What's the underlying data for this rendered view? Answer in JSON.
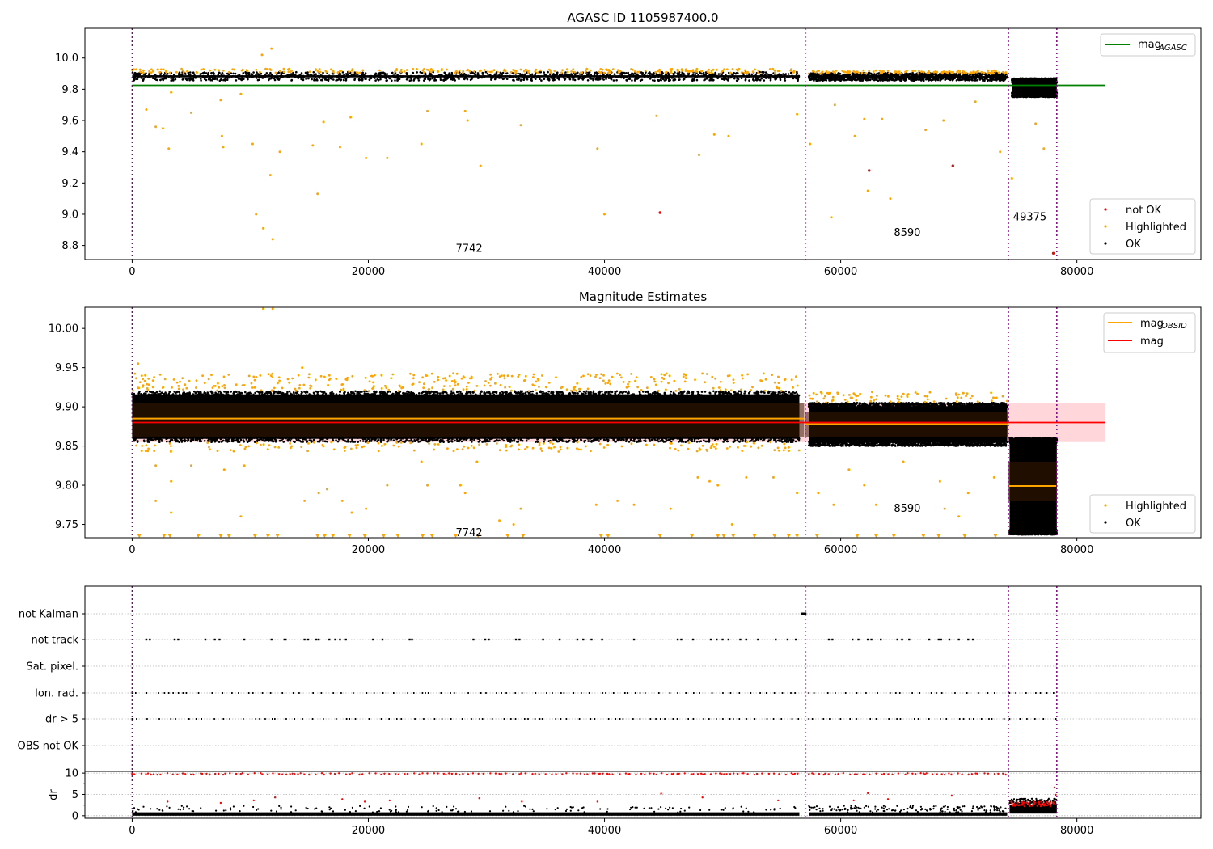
{
  "chart_data": [
    {
      "type": "scatter",
      "title": "AGASC ID 1105987400.0",
      "xlabel": "",
      "ylabel": "",
      "xlim": [
        -4000,
        90500
      ],
      "ylim": [
        8.71,
        10.19
      ],
      "x_ticks": [
        0,
        20000,
        40000,
        60000,
        80000
      ],
      "x_tick_labels": [
        "0",
        "20000",
        "40000",
        "60000",
        "80000"
      ],
      "y_ticks": [
        8.8,
        9.0,
        9.2,
        9.4,
        9.6,
        9.8,
        10.0
      ],
      "y_tick_labels": [
        "8.8",
        "9.0",
        "9.2",
        "9.4",
        "9.6",
        "9.8",
        "10.0"
      ],
      "obsid_boundaries": [
        0,
        57000,
        74200,
        78300
      ],
      "annotations": [
        {
          "text": "7742",
          "x": 27400,
          "y": 8.76
        },
        {
          "text": "8590",
          "x": 64500,
          "y": 8.86
        },
        {
          "text": "49375",
          "x": 74600,
          "y": 8.96
        }
      ],
      "lines": [
        {
          "name": "mag_AGASC",
          "value": 9.825,
          "x_range": [
            0,
            82400
          ],
          "color": "#008000"
        }
      ],
      "legend_lines": {
        "main": "mag",
        "sub": "AGASC"
      },
      "legend_points": [
        "not OK",
        "Highlighted",
        "OK"
      ],
      "series": [
        {
          "name": "OK",
          "color": "#000000",
          "bands": [
            {
              "x_range": [
                0,
                56500
              ],
              "y_range": [
                9.855,
                9.91
              ]
            },
            {
              "x_range": [
                57300,
                74100
              ],
              "y_range": [
                9.855,
                9.905
              ]
            },
            {
              "x_range": [
                74500,
                78300
              ],
              "y_range": [
                9.75,
                9.87
              ]
            }
          ]
        },
        {
          "name": "Highlighted",
          "color": "#ffa500",
          "points": [
            [
              1200,
              9.67
            ],
            [
              2000,
              9.56
            ],
            [
              2600,
              9.55
            ],
            [
              3100,
              9.42
            ],
            [
              3300,
              9.78
            ],
            [
              5000,
              9.65
            ],
            [
              7500,
              9.73
            ],
            [
              7600,
              9.5
            ],
            [
              7700,
              9.43
            ],
            [
              9200,
              9.77
            ],
            [
              10200,
              9.45
            ],
            [
              10500,
              9.0
            ],
            [
              11100,
              8.91
            ],
            [
              11000,
              10.02
            ],
            [
              11800,
              10.06
            ],
            [
              11700,
              9.25
            ],
            [
              11900,
              8.84
            ],
            [
              12500,
              9.4
            ],
            [
              15300,
              9.44
            ],
            [
              15700,
              9.13
            ],
            [
              16200,
              9.59
            ],
            [
              17600,
              9.43
            ],
            [
              18500,
              9.62
            ],
            [
              19800,
              9.36
            ],
            [
              21600,
              9.36
            ],
            [
              24500,
              9.45
            ],
            [
              25000,
              9.66
            ],
            [
              28200,
              9.66
            ],
            [
              28400,
              9.6
            ],
            [
              29500,
              9.31
            ],
            [
              32900,
              9.57
            ],
            [
              39400,
              9.42
            ],
            [
              40000,
              9.0
            ],
            [
              44400,
              9.63
            ],
            [
              48000,
              9.38
            ],
            [
              49300,
              9.51
            ],
            [
              50500,
              9.5
            ],
            [
              56300,
              9.64
            ],
            [
              57400,
              9.45
            ],
            [
              59200,
              8.98
            ],
            [
              59500,
              9.7
            ],
            [
              61200,
              9.5
            ],
            [
              62000,
              9.61
            ],
            [
              62300,
              9.15
            ],
            [
              63500,
              9.61
            ],
            [
              64200,
              9.1
            ],
            [
              67200,
              9.54
            ],
            [
              68700,
              9.6
            ],
            [
              71400,
              9.72
            ],
            [
              73500,
              9.4
            ],
            [
              74500,
              9.23
            ],
            [
              76500,
              9.58
            ],
            [
              77200,
              9.42
            ]
          ]
        },
        {
          "name": "not OK",
          "color": "#ff0000",
          "points": [
            [
              44700,
              9.01
            ],
            [
              62400,
              9.28
            ],
            [
              69500,
              9.31
            ],
            [
              78000,
              8.75
            ]
          ]
        }
      ]
    },
    {
      "type": "scatter",
      "title": "Magnitude Estimates",
      "xlabel": "",
      "ylabel": "",
      "xlim": [
        -4000,
        90500
      ],
      "ylim": [
        9.733,
        10.027
      ],
      "x_ticks": [
        0,
        20000,
        40000,
        60000,
        80000
      ],
      "x_tick_labels": [
        "0",
        "20000",
        "40000",
        "60000",
        "80000"
      ],
      "y_ticks": [
        9.75,
        9.8,
        9.85,
        9.9,
        9.95,
        10.0
      ],
      "y_tick_labels": [
        "9.75",
        "9.80",
        "9.85",
        "9.90",
        "9.95",
        "10.00"
      ],
      "obsid_boundaries": [
        0,
        57000,
        74200,
        78300
      ],
      "annotations": [
        {
          "text": "7742",
          "x": 27400,
          "y": 9.735
        },
        {
          "text": "8590",
          "x": 64500,
          "y": 9.766
        }
      ],
      "lines": [
        {
          "name": "mag",
          "value": 9.88,
          "x_range": [
            0,
            82400
          ],
          "color": "#ff0000",
          "band": [
            9.855,
            9.905
          ]
        },
        {
          "name": "mag_OBSID",
          "color": "#ffa500",
          "segments": [
            {
              "x_range": [
                0,
                56900
              ],
              "value": 9.885,
              "band": [
                9.862,
                9.905
              ]
            },
            {
              "x_range": [
                57000,
                74200
              ],
              "value": 9.878,
              "band": [
                9.862,
                9.893
              ]
            },
            {
              "x_range": [
                74200,
                78300
              ],
              "value": 9.799,
              "band": [
                9.78,
                9.83
              ]
            }
          ]
        }
      ],
      "legend_lines": [
        {
          "main": "mag",
          "sub": "OBSID"
        },
        {
          "main": "mag",
          "sub": ""
        }
      ],
      "legend_points": [
        "Highlighted",
        "OK"
      ],
      "series": [
        {
          "name": "OK",
          "color": "#000000",
          "bands": [
            {
              "x_range": [
                0,
                56500
              ],
              "y_range": [
                9.855,
                9.92
              ]
            },
            {
              "x_range": [
                57300,
                74100
              ],
              "y_range": [
                9.85,
                9.905
              ]
            },
            {
              "x_range": [
                74300,
                78300
              ],
              "y_range": [
                9.737,
                9.86
              ]
            }
          ]
        },
        {
          "name": "Highlighted",
          "color": "#ffa500",
          "points": [
            [
              500,
              9.955
            ],
            [
              2000,
              9.825
            ],
            [
              2000,
              9.78
            ],
            [
              3300,
              9.765
            ],
            [
              3300,
              9.805
            ],
            [
              5000,
              9.825
            ],
            [
              7800,
              9.82
            ],
            [
              9200,
              9.76
            ],
            [
              9500,
              9.825
            ],
            [
              11100,
              10.025
            ],
            [
              11900,
              10.025
            ],
            [
              14400,
              9.95
            ],
            [
              14600,
              9.78
            ],
            [
              15800,
              9.79
            ],
            [
              16500,
              9.795
            ],
            [
              17800,
              9.78
            ],
            [
              18600,
              9.765
            ],
            [
              19800,
              9.77
            ],
            [
              21600,
              9.8
            ],
            [
              24500,
              9.83
            ],
            [
              25000,
              9.8
            ],
            [
              27800,
              9.8
            ],
            [
              28200,
              9.79
            ],
            [
              29200,
              9.83
            ],
            [
              31100,
              9.755
            ],
            [
              32300,
              9.75
            ],
            [
              32900,
              9.77
            ],
            [
              39300,
              9.775
            ],
            [
              41100,
              9.78
            ],
            [
              42500,
              9.775
            ],
            [
              45600,
              9.77
            ],
            [
              47900,
              9.81
            ],
            [
              48900,
              9.805
            ],
            [
              49600,
              9.8
            ],
            [
              50800,
              9.75
            ],
            [
              52000,
              9.81
            ],
            [
              54300,
              9.81
            ],
            [
              56300,
              9.79
            ],
            [
              58100,
              9.79
            ],
            [
              59400,
              9.775
            ],
            [
              60700,
              9.82
            ],
            [
              62000,
              9.8
            ],
            [
              63000,
              9.775
            ],
            [
              65300,
              9.83
            ],
            [
              68400,
              9.805
            ],
            [
              68800,
              9.77
            ],
            [
              70000,
              9.76
            ],
            [
              70800,
              9.79
            ],
            [
              73000,
              9.81
            ]
          ]
        },
        {
          "name": "Highlighted (below range)",
          "color": "#ffa500",
          "marker": "triangle-down",
          "y": 9.735,
          "x": [
            600,
            2700,
            3200,
            5600,
            7500,
            8200,
            10400,
            11500,
            12300,
            15700,
            16300,
            17000,
            18400,
            19700,
            21300,
            22500,
            24600,
            25400,
            27400,
            29300,
            31800,
            33100,
            39700,
            40300,
            44700,
            47400,
            49600,
            50100,
            50900,
            52700,
            54400,
            55600,
            56300,
            58000,
            61400,
            63000,
            64500,
            67000,
            68300,
            70500,
            73100
          ]
        }
      ]
    },
    {
      "type": "scatter",
      "title": "",
      "xlabel": "",
      "ylabel": "",
      "xlim": [
        -4000,
        90500
      ],
      "x_ticks": [
        0,
        20000,
        40000,
        60000,
        80000
      ],
      "x_tick_labels": [
        "0",
        "20000",
        "40000",
        "60000",
        "80000"
      ],
      "obsid_boundaries": [
        0,
        57000,
        74200,
        78300
      ],
      "categories": [
        "not Kalman",
        "not track",
        "Sat. pixel.",
        "Ion. rad.",
        "dr > 5",
        "OBS not OK"
      ],
      "flag_series": [
        {
          "name": "not Kalman",
          "x_ranges": [
            [
              56600,
              57100
            ]
          ]
        },
        {
          "name": "not track",
          "x": [
            1200,
            1500,
            3600,
            3900,
            6200,
            7000,
            7400,
            9500,
            11800,
            12900,
            13000,
            14600,
            14900,
            15600,
            15800,
            16700,
            17200,
            17600,
            18100,
            20400,
            21200,
            23500,
            23700,
            28900,
            29900,
            30200,
            32500,
            32800,
            34800,
            36200,
            37700,
            38200,
            38900,
            39800,
            42500,
            46200,
            46500,
            47500,
            49000,
            49500,
            50000,
            50500,
            51500,
            52000,
            53000,
            54500,
            55500,
            56200,
            59000,
            59300,
            61000,
            61500,
            62300,
            62600,
            63400,
            64800,
            65200,
            65800,
            67500,
            68300,
            68500,
            69200,
            70000,
            70800,
            71200
          ]
        },
        {
          "name": "Sat. pixel.",
          "x": []
        },
        {
          "name": "Ion. rad.",
          "dense_ranges": [
            [
              0,
              56500
            ],
            [
              57300,
              74100
            ],
            [
              74300,
              78300
            ]
          ]
        },
        {
          "name": "dr > 5",
          "dense_ranges": [
            [
              0,
              56500
            ],
            [
              57300,
              74100
            ],
            [
              74300,
              78300
            ]
          ]
        },
        {
          "name": "OBS not OK",
          "x": []
        }
      ]
    },
    {
      "type": "scatter",
      "title": "",
      "xlabel": "",
      "ylabel": "dr",
      "xlim": [
        -4000,
        90500
      ],
      "ylim": [
        -0.6,
        10.4
      ],
      "y_ticks": [
        0,
        5,
        10
      ],
      "y_tick_labels": [
        "0",
        "5",
        "10"
      ],
      "x_ticks": [
        0,
        20000,
        40000,
        60000,
        80000
      ],
      "x_tick_labels": [
        "0",
        "20000",
        "40000",
        "60000",
        "80000"
      ],
      "obsid_boundaries": [
        0,
        57000,
        74200,
        78300
      ],
      "series": [
        {
          "name": "OK",
          "color": "#000000",
          "bands": [
            {
              "x_range": [
                0,
                56500
              ],
              "y_range": [
                0,
                0.8
              ]
            },
            {
              "x_range": [
                57300,
                74100
              ],
              "y_range": [
                0,
                0.8
              ]
            },
            {
              "x_range": [
                74300,
                78300
              ],
              "y_range": [
                0.5,
                2.5
              ]
            }
          ]
        },
        {
          "name": "not OK",
          "color": "#ff0000",
          "y": 9.8,
          "dense_ranges": [
            [
              0,
              56500
            ],
            [
              57300,
              74100
            ]
          ],
          "points": [
            [
              3000,
              3.3
            ],
            [
              7500,
              3.0
            ],
            [
              10300,
              3.6
            ],
            [
              12100,
              4.3
            ],
            [
              17800,
              3.9
            ],
            [
              19700,
              3.3
            ],
            [
              21800,
              3.6
            ],
            [
              29400,
              4.1
            ],
            [
              33000,
              3.3
            ],
            [
              39400,
              3.3
            ],
            [
              44800,
              5.2
            ],
            [
              48300,
              4.3
            ],
            [
              54700,
              3.6
            ],
            [
              61100,
              3.6
            ],
            [
              62300,
              5.3
            ],
            [
              64000,
              3.9
            ],
            [
              69400,
              4.7
            ],
            [
              78100,
              6.6
            ],
            [
              78200,
              4.9
            ]
          ]
        }
      ]
    }
  ]
}
